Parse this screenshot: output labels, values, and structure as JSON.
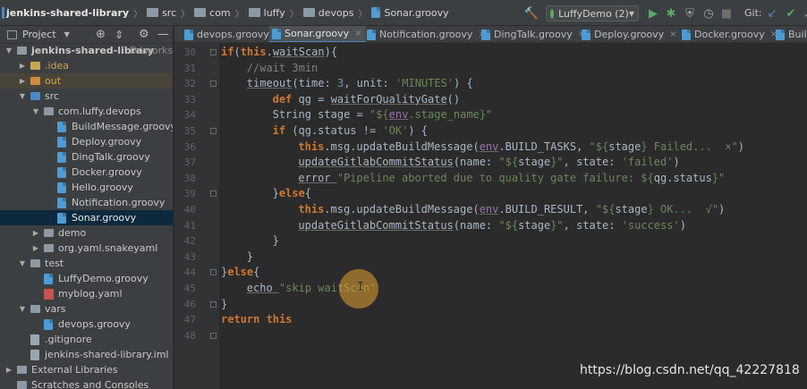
{
  "breadcrumb": {
    "items": [
      "jenkins-shared-library",
      "src",
      "com",
      "luffy",
      "devops",
      "Sonar.groovy"
    ]
  },
  "toolbar": {
    "run_config": "LuffyDemo (2)",
    "git_label": "Git:"
  },
  "project_panel": {
    "title": "Project",
    "tree": [
      {
        "label": "jenkins-shared-library",
        "suffix": "D:\\worksp",
        "level": 0,
        "expanded": true,
        "kind": "module"
      },
      {
        "label": ".idea",
        "level": 1,
        "expanded": false,
        "kind": "folder-yellow"
      },
      {
        "label": "out",
        "level": 1,
        "expanded": false,
        "kind": "folder-orange"
      },
      {
        "label": "src",
        "level": 1,
        "expanded": true,
        "kind": "folder-blue"
      },
      {
        "label": "com.luffy.devops",
        "level": 2,
        "expanded": true,
        "kind": "package"
      },
      {
        "label": "BuildMessage.groovy",
        "level": 3,
        "kind": "groovy"
      },
      {
        "label": "Deploy.groovy",
        "level": 3,
        "kind": "groovy"
      },
      {
        "label": "DingTalk.groovy",
        "level": 3,
        "kind": "groovy"
      },
      {
        "label": "Docker.groovy",
        "level": 3,
        "kind": "groovy"
      },
      {
        "label": "Hello.groovy",
        "level": 3,
        "kind": "groovy"
      },
      {
        "label": "Notification.groovy",
        "level": 3,
        "kind": "groovy"
      },
      {
        "label": "Sonar.groovy",
        "level": 3,
        "kind": "groovy",
        "selected": true
      },
      {
        "label": "demo",
        "level": 2,
        "expanded": false,
        "kind": "package"
      },
      {
        "label": "org.yaml.snakeyaml",
        "level": 2,
        "expanded": false,
        "kind": "package"
      },
      {
        "label": "test",
        "level": 1,
        "expanded": true,
        "kind": "folder"
      },
      {
        "label": "LuffyDemo.groovy",
        "level": 2,
        "kind": "groovy"
      },
      {
        "label": "myblog.yaml",
        "level": 2,
        "kind": "yaml"
      },
      {
        "label": "vars",
        "level": 1,
        "expanded": true,
        "kind": "folder"
      },
      {
        "label": "devops.groovy",
        "level": 2,
        "kind": "groovy"
      },
      {
        "label": ".gitignore",
        "level": 1,
        "kind": "file"
      },
      {
        "label": "jenkins-shared-library.iml",
        "level": 1,
        "kind": "file"
      },
      {
        "label": "External Libraries",
        "level": 0,
        "expanded": false,
        "kind": "lib"
      },
      {
        "label": "Scratches and Consoles",
        "level": 0,
        "kind": "scratch"
      }
    ]
  },
  "tabs": [
    {
      "label": "devops.groovy",
      "active": false
    },
    {
      "label": "Sonar.groovy",
      "active": true
    },
    {
      "label": "Notification.groovy",
      "active": false
    },
    {
      "label": "DingTalk.groovy",
      "active": false
    },
    {
      "label": "Deploy.groovy",
      "active": false
    },
    {
      "label": "Docker.groovy",
      "active": false
    },
    {
      "label": "Buil",
      "active": false
    }
  ],
  "editor": {
    "line_numbers": [
      "30",
      "31",
      "32",
      "33",
      "34",
      "35",
      "36",
      "37",
      "38",
      "39",
      "40",
      "41",
      "42",
      "43",
      "44",
      "45",
      "46",
      "47",
      "48"
    ],
    "lines": [
      [
        [
          "kw",
          "if"
        ],
        [
          "",
          "("
        ],
        [
          "kw",
          "this"
        ],
        [
          "",
          "."
        ],
        [
          "ul",
          "waitScan"
        ],
        [
          "",
          "){"
        ]
      ],
      [
        [
          "cmt",
          "//wait 3min"
        ]
      ],
      [
        [
          "ul",
          "timeout"
        ],
        [
          "",
          "("
        ],
        [
          "param",
          "time: "
        ],
        [
          "num",
          "3"
        ],
        [
          "",
          ", "
        ],
        [
          "param",
          "unit: "
        ],
        [
          "str",
          "'MINUTES'"
        ],
        [
          "",
          ") {"
        ]
      ],
      [
        [
          "kw",
          "def "
        ],
        [
          "",
          "qg = "
        ],
        [
          "ul",
          "waitForQualityGate"
        ],
        [
          "",
          "()"
        ]
      ],
      [
        [
          "",
          "String stage = "
        ],
        [
          "str",
          "\"${"
        ],
        [
          "ul purple",
          "env"
        ],
        [
          "str",
          ".stage_name}\""
        ]
      ],
      [
        [
          "kw",
          "if "
        ],
        [
          "",
          "(qg.status != "
        ],
        [
          "str",
          "'OK'"
        ],
        [
          "",
          ") {"
        ]
      ],
      [
        [
          "kw",
          "this"
        ],
        [
          "",
          ".msg.updateBuildMessage("
        ],
        [
          "ul purple",
          "env"
        ],
        [
          "",
          ".BUILD_TASKS, "
        ],
        [
          "str",
          "\"${"
        ],
        [
          "",
          "stage"
        ],
        [
          "str",
          "} Failed...  ×\""
        ],
        [
          "",
          ")"
        ]
      ],
      [
        [
          "ul",
          "updateGitlabCommitStatus"
        ],
        [
          "",
          "("
        ],
        [
          "param",
          "name: "
        ],
        [
          "str",
          "\"${"
        ],
        [
          "",
          "stage"
        ],
        [
          "str",
          "}\""
        ],
        [
          "",
          ", "
        ],
        [
          "param",
          "state: "
        ],
        [
          "str",
          "'failed'"
        ],
        [
          "",
          ")"
        ]
      ],
      [
        [
          "ul",
          "error "
        ],
        [
          "str",
          "\"Pipeline aborted due to quality gate failure: ${"
        ],
        [
          "",
          "qg.status"
        ],
        [
          "str",
          "}\""
        ]
      ],
      [
        [
          "",
          "}"
        ],
        [
          "kw",
          "else"
        ],
        [
          "",
          "{"
        ]
      ],
      [
        [
          "kw",
          "this"
        ],
        [
          "",
          ".msg.updateBuildMessage("
        ],
        [
          "ul purple",
          "env"
        ],
        [
          "",
          ".BUILD_RESULT, "
        ],
        [
          "str",
          "\"${"
        ],
        [
          "",
          "stage"
        ],
        [
          "str",
          "} OK...  √\""
        ],
        [
          "",
          ")"
        ]
      ],
      [
        [
          "ul",
          "updateGitlabCommitStatus"
        ],
        [
          "",
          "("
        ],
        [
          "param",
          "name: "
        ],
        [
          "str",
          "\"${"
        ],
        [
          "",
          "stage"
        ],
        [
          "str",
          "}\""
        ],
        [
          "",
          ", "
        ],
        [
          "param",
          "state: "
        ],
        [
          "str",
          "'success'"
        ],
        [
          "",
          ")"
        ]
      ],
      [
        [
          "",
          "}"
        ]
      ],
      [
        [
          "",
          "}"
        ]
      ],
      [
        [
          "",
          "}"
        ],
        [
          "kw",
          "else"
        ],
        [
          "",
          "{"
        ]
      ],
      [
        [
          "ul",
          "echo "
        ],
        [
          "str",
          "\"skip waitScan\""
        ]
      ],
      [
        [
          "",
          "}"
        ]
      ],
      [
        [
          "kw",
          "return this"
        ]
      ],
      [
        [
          "",
          "}"
        ]
      ]
    ],
    "indents": [
      3,
      4,
      4,
      5,
      5,
      5,
      6,
      6,
      6,
      5,
      6,
      6,
      5,
      4,
      3,
      4,
      3,
      3,
      0
    ]
  },
  "watermark": "https://blog.csdn.net/qq_42227818",
  "colors": {
    "keyword": "#cc7832",
    "string": "#6a8759",
    "number": "#6897bb",
    "comment": "#808080",
    "selection": "#0d293e",
    "cursor_highlight": "#e6a032"
  }
}
